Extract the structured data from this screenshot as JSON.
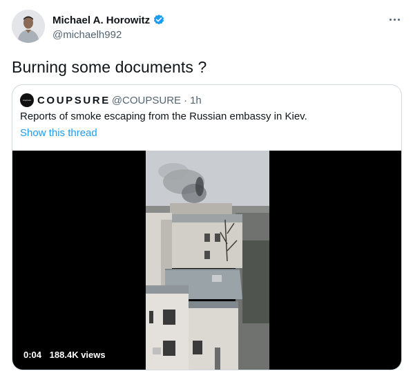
{
  "author": {
    "display_name": "Michael A. Horowitz",
    "handle": "@michaelh992",
    "verified": true
  },
  "tweet": {
    "text": "Burning some documents ?"
  },
  "quoted": {
    "name": "COUPSURE",
    "handle": "@COUPSURE",
    "separator": "·",
    "time": "1h",
    "text": "Reports of smoke escaping from the Russian embassy in Kiev.",
    "show_thread": "Show this thread"
  },
  "video": {
    "timestamp": "0:04",
    "views": "188.4K views"
  },
  "icons": {
    "verified": "verified-badge-icon",
    "more": "more-options-icon",
    "play": "video-player"
  },
  "colors": {
    "link": "#1d9bf0",
    "secondary_text": "#536471",
    "primary_text": "#0f1419",
    "border": "#cfd9de",
    "verified": "#1d9bf0"
  }
}
